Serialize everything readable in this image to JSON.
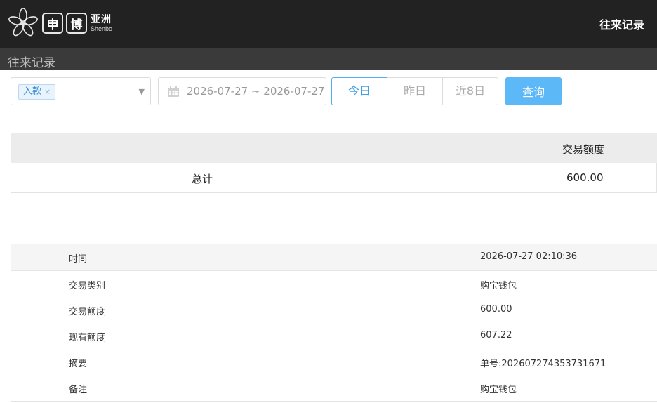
{
  "header": {
    "logo_char1": "申",
    "logo_char2": "博",
    "logo_asia": "亚洲",
    "logo_sub": "Shenbo",
    "page_title": "往来记录"
  },
  "subheader": {
    "title": "往来记录"
  },
  "filters": {
    "type_tag": "入款",
    "tag_remove": "×",
    "date_range": "2026-07-27 ~ 2026-07-27",
    "quick_ranges": [
      "今日",
      "昨日",
      "近8日"
    ],
    "active_range": "今日",
    "query_label": "查询"
  },
  "summary": {
    "column_header": "交易额度",
    "total_label": "总计",
    "total_value": "600.00"
  },
  "record": [
    {
      "label": "时间",
      "value": "2026-07-27 02:10:36"
    },
    {
      "label": "交易类别",
      "value": "购宝钱包"
    },
    {
      "label": "交易额度",
      "value": "600.00"
    },
    {
      "label": "现有额度",
      "value": "607.22"
    },
    {
      "label": "摘要",
      "value": "单号:202607274353731671"
    },
    {
      "label": "备注",
      "value": "购宝钱包"
    }
  ],
  "colors": {
    "topbar": "#222222",
    "subbar": "#3a3a3a",
    "accent": "#5cb8f7",
    "active_border": "#4fb0f4",
    "tag_text": "#3d8fd6"
  }
}
